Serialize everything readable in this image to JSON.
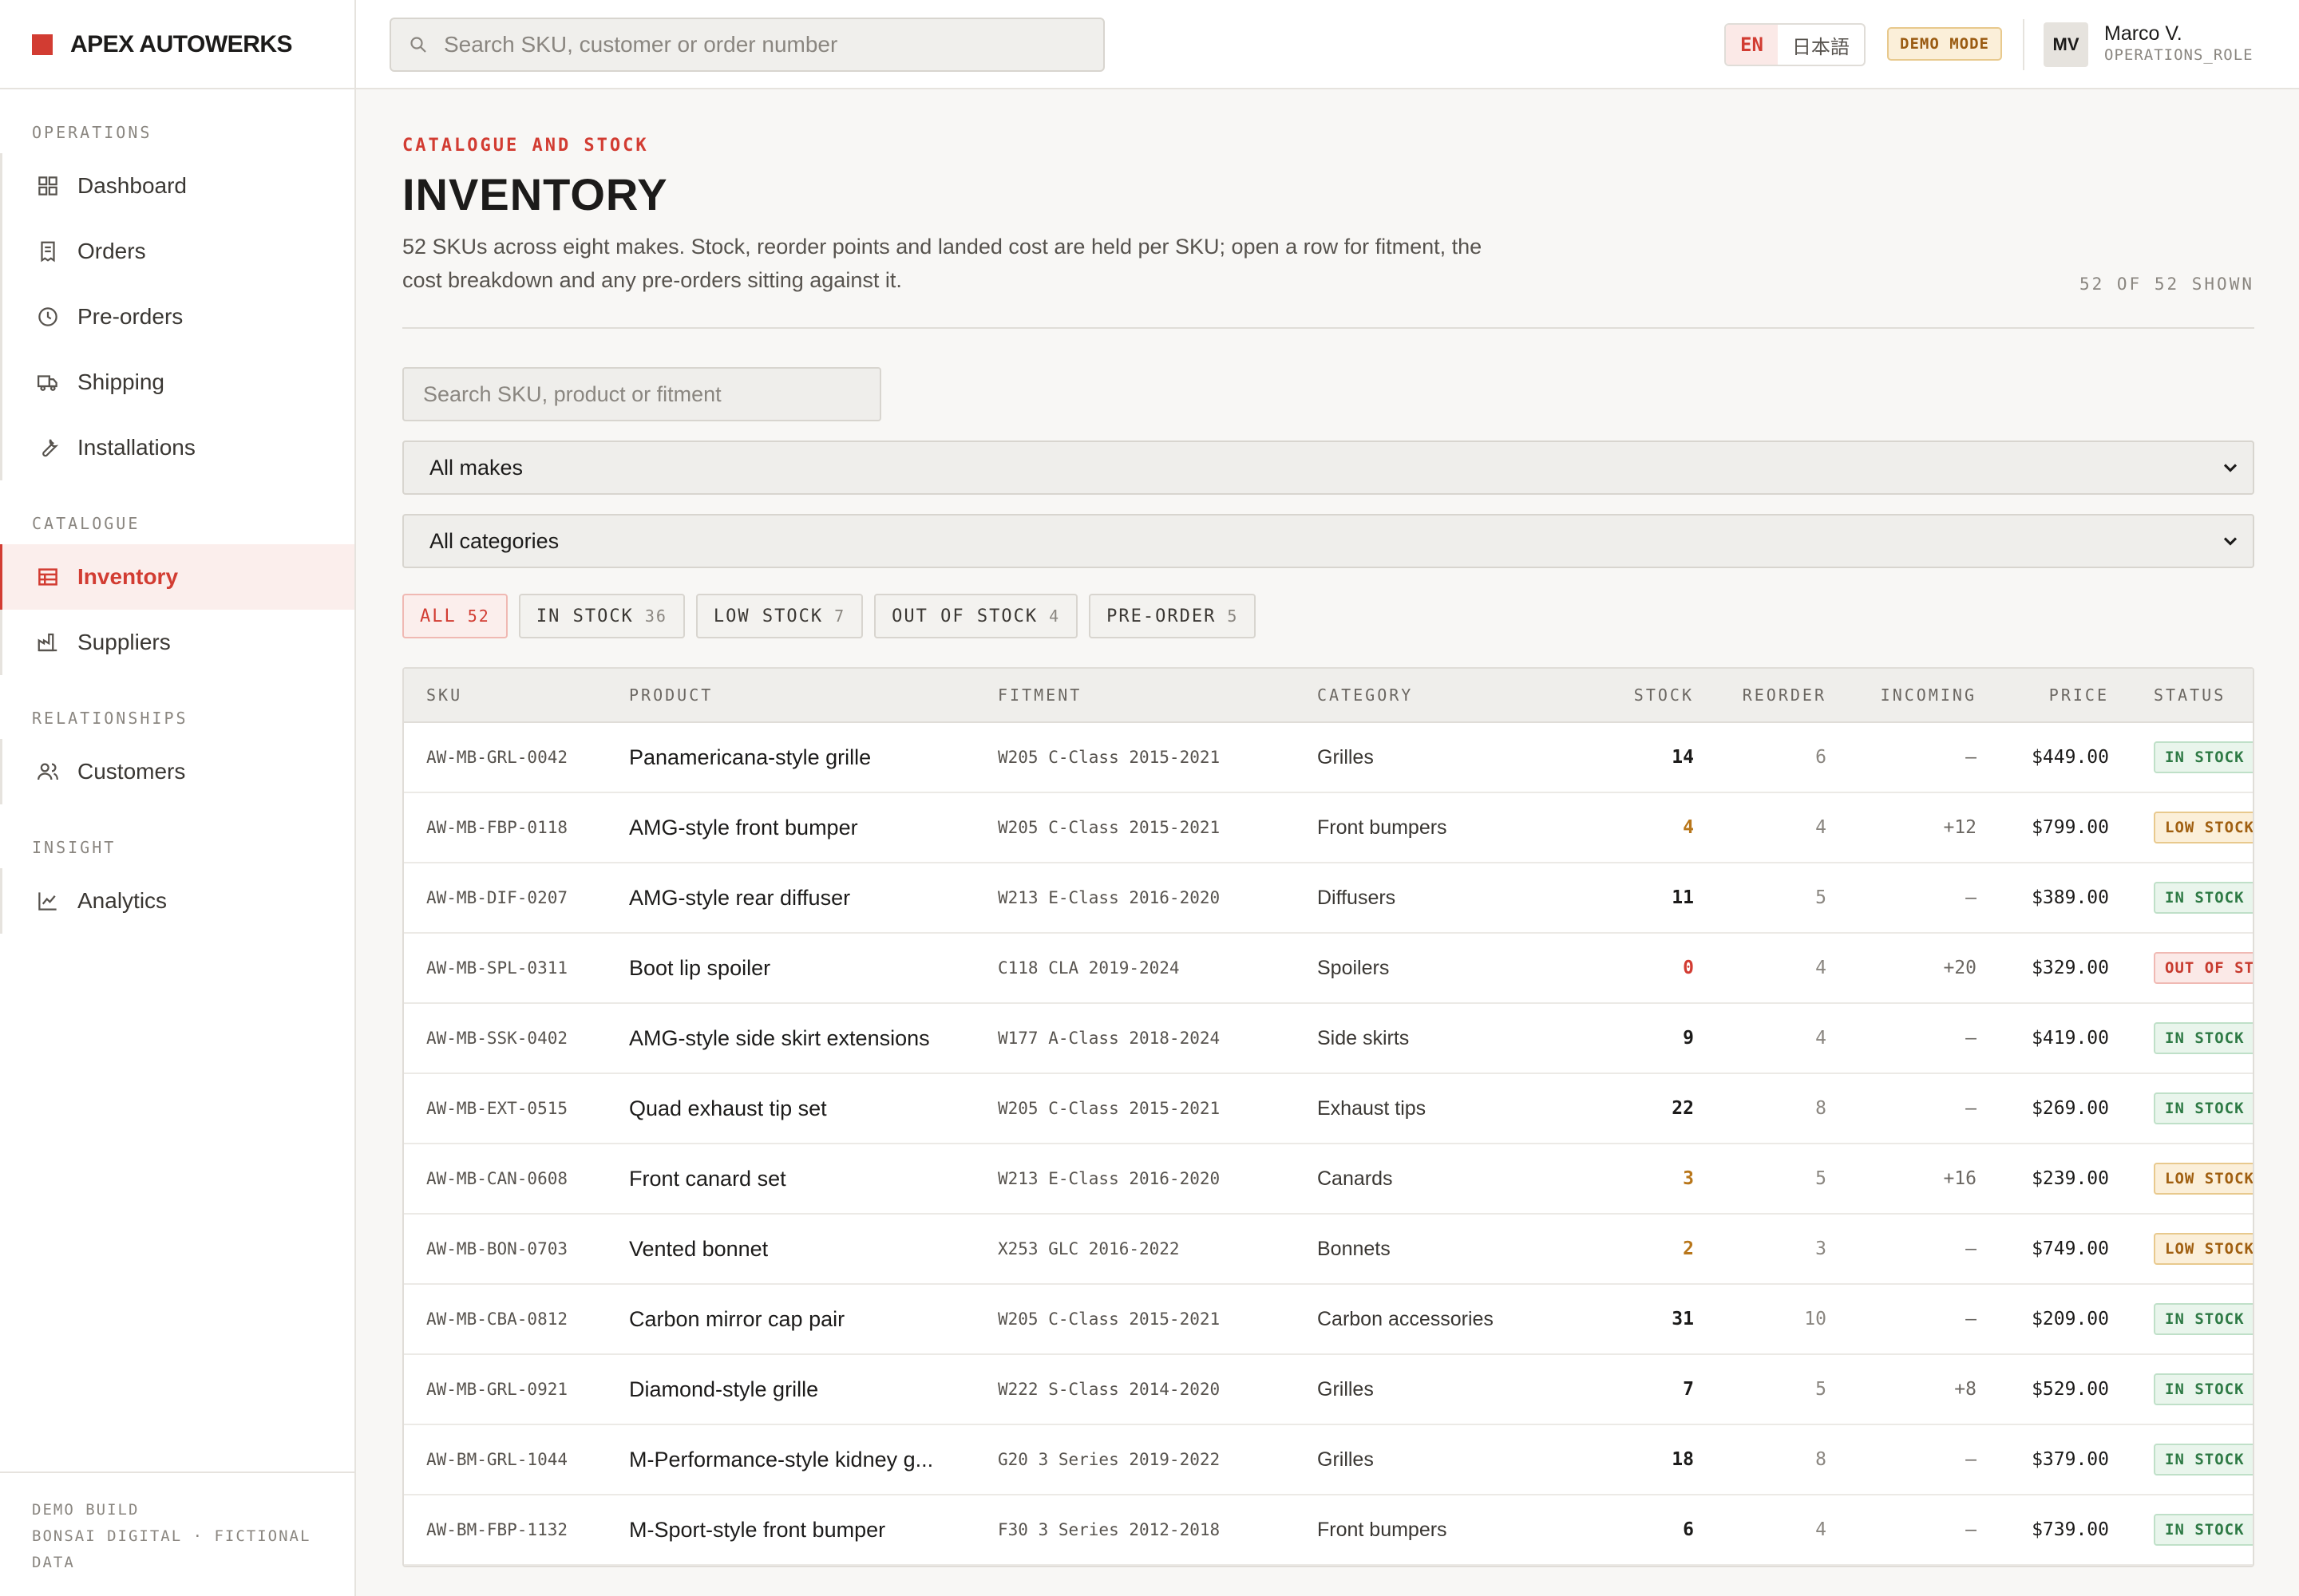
{
  "brand": {
    "name": "APEX AUTOWERKS",
    "accent": "#d23c32"
  },
  "topbar": {
    "search_placeholder": "Search SKU, customer or order number",
    "lang_en": "EN",
    "lang_ja": "日本語",
    "demo_badge": "DEMO MODE",
    "user_initials": "MV",
    "user_name": "Marco V.",
    "user_role": "OPERATIONS_ROLE"
  },
  "sidebar": {
    "sections": [
      {
        "heading": "OPERATIONS",
        "items": [
          {
            "label": "Dashboard",
            "icon": "grid-icon"
          },
          {
            "label": "Orders",
            "icon": "receipt-icon"
          },
          {
            "label": "Pre-orders",
            "icon": "clock-icon"
          },
          {
            "label": "Shipping",
            "icon": "truck-icon"
          },
          {
            "label": "Installations",
            "icon": "wrench-icon"
          }
        ]
      },
      {
        "heading": "CATALOGUE",
        "items": [
          {
            "label": "Inventory",
            "icon": "table-icon",
            "active": true
          },
          {
            "label": "Suppliers",
            "icon": "factory-icon"
          }
        ]
      },
      {
        "heading": "RELATIONSHIPS",
        "items": [
          {
            "label": "Customers",
            "icon": "users-icon"
          }
        ]
      },
      {
        "heading": "INSIGHT",
        "items": [
          {
            "label": "Analytics",
            "icon": "line-chart-icon"
          }
        ]
      }
    ],
    "footer_line1": "DEMO BUILD",
    "footer_line2": "BONSAI DIGITAL · FICTIONAL DATA"
  },
  "page": {
    "eyebrow": "CATALOGUE AND STOCK",
    "title": "INVENTORY",
    "description": "52 SKUs across eight makes. Stock, reorder points and landed cost are held per SKU; open a row for fitment, the cost breakdown and any pre-orders sitting against it.",
    "shown": "52 OF 52 SHOWN"
  },
  "filters": {
    "search_placeholder": "Search SKU, product or fitment",
    "make_selected": "All makes",
    "category_selected": "All categories",
    "chips": [
      {
        "label": "ALL",
        "count": "52",
        "active": true
      },
      {
        "label": "IN STOCK",
        "count": "36"
      },
      {
        "label": "LOW STOCK",
        "count": "7"
      },
      {
        "label": "OUT OF STOCK",
        "count": "4"
      },
      {
        "label": "PRE-ORDER",
        "count": "5"
      }
    ]
  },
  "table": {
    "headers": {
      "sku": "SKU",
      "product": "PRODUCT",
      "fitment": "FITMENT",
      "category": "CATEGORY",
      "stock": "STOCK",
      "reorder": "REORDER",
      "incoming": "INCOMING",
      "price": "PRICE",
      "status": "STATUS"
    },
    "rows": [
      {
        "sku": "AW-MB-GRL-0042",
        "product": "Panamericana-style grille",
        "fitment": "W205 C-Class 2015-2021",
        "category": "Grilles",
        "stock": "14",
        "reorder": "6",
        "incoming": "—",
        "price": "$449.00",
        "status": "IN STOCK",
        "level": "in"
      },
      {
        "sku": "AW-MB-FBP-0118",
        "product": "AMG-style front bumper",
        "fitment": "W205 C-Class 2015-2021",
        "category": "Front bumpers",
        "stock": "4",
        "reorder": "4",
        "incoming": "+12",
        "price": "$799.00",
        "status": "LOW STOCK",
        "level": "low"
      },
      {
        "sku": "AW-MB-DIF-0207",
        "product": "AMG-style rear diffuser",
        "fitment": "W213 E-Class 2016-2020",
        "category": "Diffusers",
        "stock": "11",
        "reorder": "5",
        "incoming": "—",
        "price": "$389.00",
        "status": "IN STOCK",
        "level": "in"
      },
      {
        "sku": "AW-MB-SPL-0311",
        "product": "Boot lip spoiler",
        "fitment": "C118 CLA 2019-2024",
        "category": "Spoilers",
        "stock": "0",
        "reorder": "4",
        "incoming": "+20",
        "price": "$329.00",
        "status": "OUT OF STOCK",
        "level": "out"
      },
      {
        "sku": "AW-MB-SSK-0402",
        "product": "AMG-style side skirt extensions",
        "fitment": "W177 A-Class 2018-2024",
        "category": "Side skirts",
        "stock": "9",
        "reorder": "4",
        "incoming": "—",
        "price": "$419.00",
        "status": "IN STOCK",
        "level": "in"
      },
      {
        "sku": "AW-MB-EXT-0515",
        "product": "Quad exhaust tip set",
        "fitment": "W205 C-Class 2015-2021",
        "category": "Exhaust tips",
        "stock": "22",
        "reorder": "8",
        "incoming": "—",
        "price": "$269.00",
        "status": "IN STOCK",
        "level": "in"
      },
      {
        "sku": "AW-MB-CAN-0608",
        "product": "Front canard set",
        "fitment": "W213 E-Class 2016-2020",
        "category": "Canards",
        "stock": "3",
        "reorder": "5",
        "incoming": "+16",
        "price": "$239.00",
        "status": "LOW STOCK",
        "level": "low"
      },
      {
        "sku": "AW-MB-BON-0703",
        "product": "Vented bonnet",
        "fitment": "X253 GLC 2016-2022",
        "category": "Bonnets",
        "stock": "2",
        "reorder": "3",
        "incoming": "—",
        "price": "$749.00",
        "status": "LOW STOCK",
        "level": "low"
      },
      {
        "sku": "AW-MB-CBA-0812",
        "product": "Carbon mirror cap pair",
        "fitment": "W205 C-Class 2015-2021",
        "category": "Carbon accessories",
        "stock": "31",
        "reorder": "10",
        "incoming": "—",
        "price": "$209.00",
        "status": "IN STOCK",
        "level": "in"
      },
      {
        "sku": "AW-MB-GRL-0921",
        "product": "Diamond-style grille",
        "fitment": "W222 S-Class 2014-2020",
        "category": "Grilles",
        "stock": "7",
        "reorder": "5",
        "incoming": "+8",
        "price": "$529.00",
        "status": "IN STOCK",
        "level": "in"
      },
      {
        "sku": "AW-BM-GRL-1044",
        "product": "M-Performance-style kidney g...",
        "fitment": "G20 3 Series 2019-2022",
        "category": "Grilles",
        "stock": "18",
        "reorder": "8",
        "incoming": "—",
        "price": "$379.00",
        "status": "IN STOCK",
        "level": "in"
      },
      {
        "sku": "AW-BM-FBP-1132",
        "product": "M-Sport-style front bumper",
        "fitment": "F30 3 Series 2012-2018",
        "category": "Front bumpers",
        "stock": "6",
        "reorder": "4",
        "incoming": "—",
        "price": "$739.00",
        "status": "IN STOCK",
        "level": "in"
      }
    ]
  }
}
